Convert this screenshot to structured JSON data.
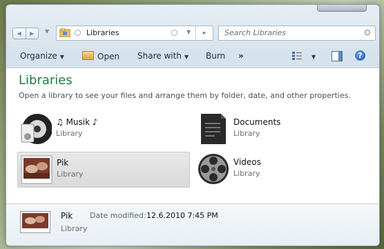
{
  "address": {
    "location": "Libraries"
  },
  "search": {
    "placeholder": "Search Libraries"
  },
  "toolbar": {
    "organize": "Organize",
    "open": "Open",
    "share_with": "Share with",
    "burn": "Burn",
    "more": "»"
  },
  "main": {
    "title": "Libraries",
    "subtitle": "Open a library to see your files and arrange them by folder, date, and other properties."
  },
  "libraries": [
    {
      "name": "♫ Musik ♪",
      "kind": "Library",
      "icon": "music-library-icon",
      "selected": false
    },
    {
      "name": "Documents",
      "kind": "Library",
      "icon": "documents-library-icon",
      "selected": false
    },
    {
      "name": "Pik",
      "kind": "Library",
      "icon": "pictures-library-icon",
      "selected": true
    },
    {
      "name": "Videos",
      "kind": "Library",
      "icon": "videos-library-icon",
      "selected": false
    }
  ],
  "details": {
    "name": "Pik",
    "kind": "Library",
    "date_modified_label": "Date modified:",
    "date_modified": "12.6.2010 7:45 PM"
  },
  "colors": {
    "title_green": "#1e7b3c",
    "selection_gray": "#dadada"
  }
}
